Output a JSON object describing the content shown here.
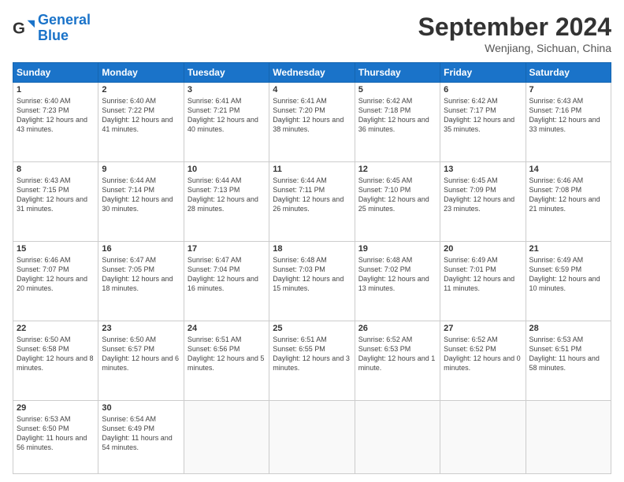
{
  "header": {
    "logo_general": "General",
    "logo_blue": "Blue",
    "month_title": "September 2024",
    "subtitle": "Wenjiang, Sichuan, China"
  },
  "weekdays": [
    "Sunday",
    "Monday",
    "Tuesday",
    "Wednesday",
    "Thursday",
    "Friday",
    "Saturday"
  ],
  "weeks": [
    [
      {
        "day": "1",
        "sunrise": "6:40 AM",
        "sunset": "7:23 PM",
        "daylight": "12 hours and 43 minutes."
      },
      {
        "day": "2",
        "sunrise": "6:40 AM",
        "sunset": "7:22 PM",
        "daylight": "12 hours and 41 minutes."
      },
      {
        "day": "3",
        "sunrise": "6:41 AM",
        "sunset": "7:21 PM",
        "daylight": "12 hours and 40 minutes."
      },
      {
        "day": "4",
        "sunrise": "6:41 AM",
        "sunset": "7:20 PM",
        "daylight": "12 hours and 38 minutes."
      },
      {
        "day": "5",
        "sunrise": "6:42 AM",
        "sunset": "7:18 PM",
        "daylight": "12 hours and 36 minutes."
      },
      {
        "day": "6",
        "sunrise": "6:42 AM",
        "sunset": "7:17 PM",
        "daylight": "12 hours and 35 minutes."
      },
      {
        "day": "7",
        "sunrise": "6:43 AM",
        "sunset": "7:16 PM",
        "daylight": "12 hours and 33 minutes."
      }
    ],
    [
      {
        "day": "8",
        "sunrise": "6:43 AM",
        "sunset": "7:15 PM",
        "daylight": "12 hours and 31 minutes."
      },
      {
        "day": "9",
        "sunrise": "6:44 AM",
        "sunset": "7:14 PM",
        "daylight": "12 hours and 30 minutes."
      },
      {
        "day": "10",
        "sunrise": "6:44 AM",
        "sunset": "7:13 PM",
        "daylight": "12 hours and 28 minutes."
      },
      {
        "day": "11",
        "sunrise": "6:44 AM",
        "sunset": "7:11 PM",
        "daylight": "12 hours and 26 minutes."
      },
      {
        "day": "12",
        "sunrise": "6:45 AM",
        "sunset": "7:10 PM",
        "daylight": "12 hours and 25 minutes."
      },
      {
        "day": "13",
        "sunrise": "6:45 AM",
        "sunset": "7:09 PM",
        "daylight": "12 hours and 23 minutes."
      },
      {
        "day": "14",
        "sunrise": "6:46 AM",
        "sunset": "7:08 PM",
        "daylight": "12 hours and 21 minutes."
      }
    ],
    [
      {
        "day": "15",
        "sunrise": "6:46 AM",
        "sunset": "7:07 PM",
        "daylight": "12 hours and 20 minutes."
      },
      {
        "day": "16",
        "sunrise": "6:47 AM",
        "sunset": "7:05 PM",
        "daylight": "12 hours and 18 minutes."
      },
      {
        "day": "17",
        "sunrise": "6:47 AM",
        "sunset": "7:04 PM",
        "daylight": "12 hours and 16 minutes."
      },
      {
        "day": "18",
        "sunrise": "6:48 AM",
        "sunset": "7:03 PM",
        "daylight": "12 hours and 15 minutes."
      },
      {
        "day": "19",
        "sunrise": "6:48 AM",
        "sunset": "7:02 PM",
        "daylight": "12 hours and 13 minutes."
      },
      {
        "day": "20",
        "sunrise": "6:49 AM",
        "sunset": "7:01 PM",
        "daylight": "12 hours and 11 minutes."
      },
      {
        "day": "21",
        "sunrise": "6:49 AM",
        "sunset": "6:59 PM",
        "daylight": "12 hours and 10 minutes."
      }
    ],
    [
      {
        "day": "22",
        "sunrise": "6:50 AM",
        "sunset": "6:58 PM",
        "daylight": "12 hours and 8 minutes."
      },
      {
        "day": "23",
        "sunrise": "6:50 AM",
        "sunset": "6:57 PM",
        "daylight": "12 hours and 6 minutes."
      },
      {
        "day": "24",
        "sunrise": "6:51 AM",
        "sunset": "6:56 PM",
        "daylight": "12 hours and 5 minutes."
      },
      {
        "day": "25",
        "sunrise": "6:51 AM",
        "sunset": "6:55 PM",
        "daylight": "12 hours and 3 minutes."
      },
      {
        "day": "26",
        "sunrise": "6:52 AM",
        "sunset": "6:53 PM",
        "daylight": "12 hours and 1 minute."
      },
      {
        "day": "27",
        "sunrise": "6:52 AM",
        "sunset": "6:52 PM",
        "daylight": "12 hours and 0 minutes."
      },
      {
        "day": "28",
        "sunrise": "6:53 AM",
        "sunset": "6:51 PM",
        "daylight": "11 hours and 58 minutes."
      }
    ],
    [
      {
        "day": "29",
        "sunrise": "6:53 AM",
        "sunset": "6:50 PM",
        "daylight": "11 hours and 56 minutes."
      },
      {
        "day": "30",
        "sunrise": "6:54 AM",
        "sunset": "6:49 PM",
        "daylight": "11 hours and 54 minutes."
      },
      null,
      null,
      null,
      null,
      null
    ]
  ]
}
